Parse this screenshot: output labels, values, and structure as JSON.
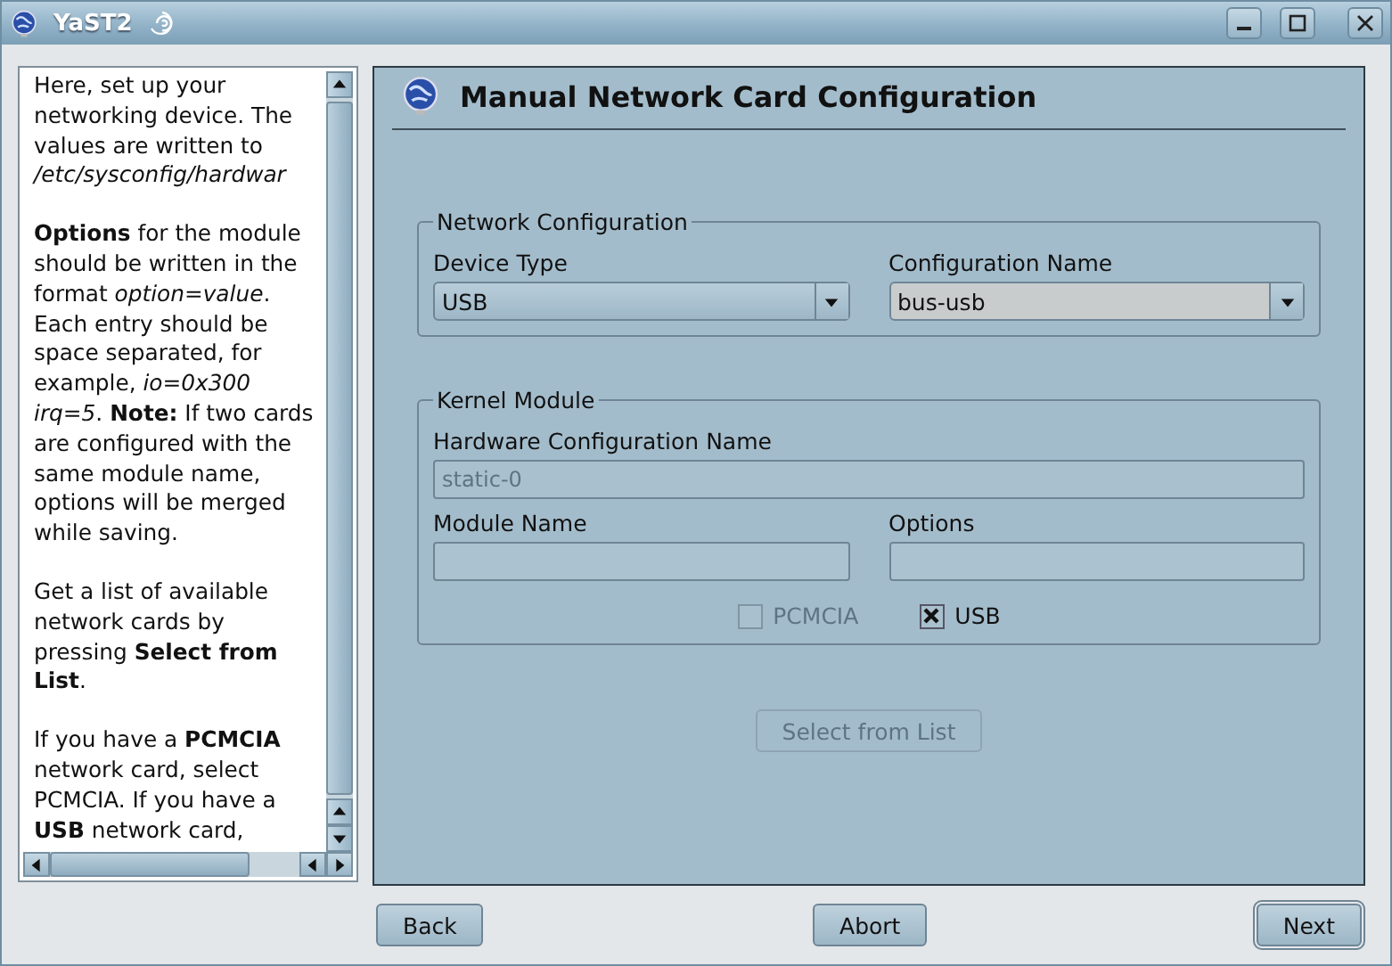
{
  "window": {
    "title": "YaST2"
  },
  "help": {
    "paragraphs": [
      "Here, set up your networking device. The values are written to */etc/sysconfig/hardwar*",
      "**Options** for the module should be written in the format *option=value*. Each entry should be space separated, for example, *io=0x300 irq=5*. **Note:** If two cards are configured with the same module name, options will be merged while saving.",
      "Get a list of available network cards by pressing **Select from List**.",
      "If you have a **PCMCIA** network card, select PCMCIA. If you have a **USB** network card,"
    ]
  },
  "dialog": {
    "title": "Manual Network Card Configuration",
    "network_configuration": {
      "legend": "Network Configuration",
      "fields": [
        {
          "label": "Device Type",
          "value": "USB",
          "editable": false
        },
        {
          "label": "Configuration Name",
          "value": "bus-usb",
          "editable": true
        }
      ]
    },
    "kernel_module": {
      "legend": "Kernel Module",
      "hardware_configuration_name": {
        "label": "Hardware Configuration Name",
        "value": "static-0",
        "disabled": true
      },
      "fields": [
        {
          "label": "Module Name"
        },
        {
          "label": "Options"
        }
      ],
      "checkboxes": [
        {
          "label": "PCMCIA",
          "checked": false,
          "disabled": true
        },
        {
          "label": "USB",
          "checked": true,
          "disabled": false
        }
      ]
    },
    "select_button": {
      "label": "Select from List",
      "disabled": true
    }
  },
  "buttons": [
    {
      "label": "Back",
      "default": false
    },
    {
      "label": "Abort",
      "default": false
    },
    {
      "label": "Next",
      "default": true
    }
  ]
}
